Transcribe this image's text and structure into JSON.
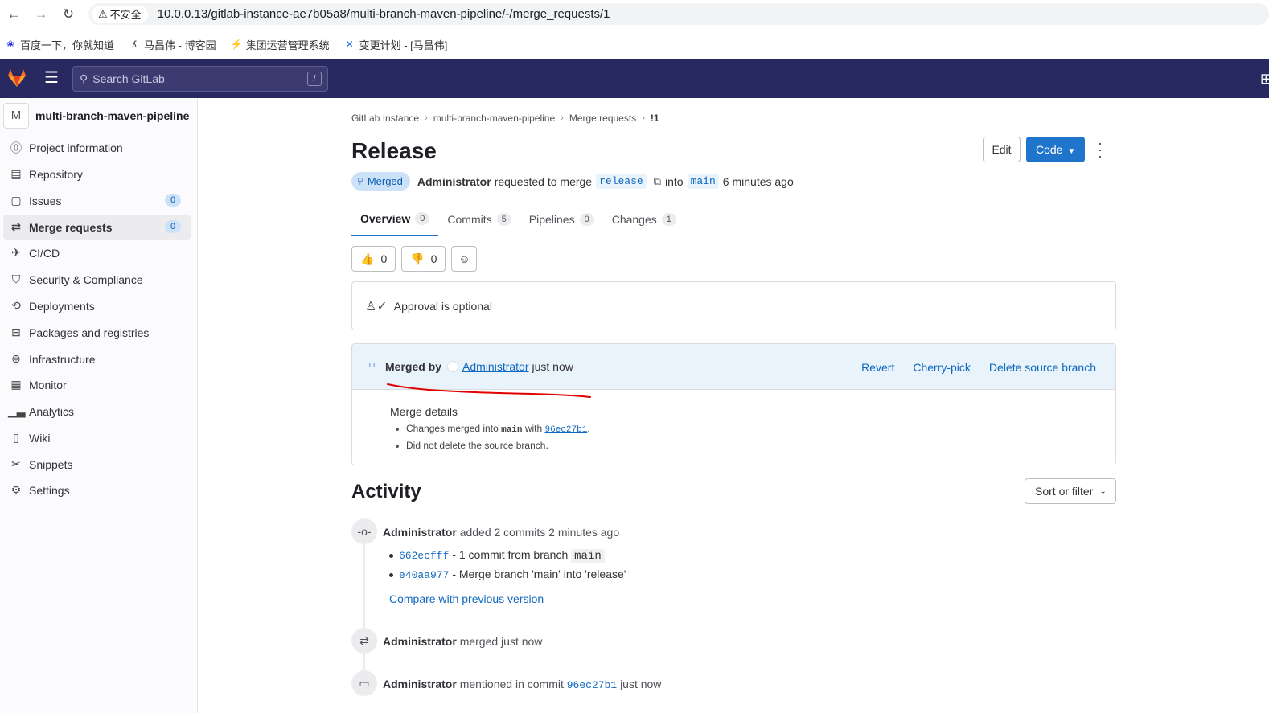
{
  "browser": {
    "insecure_label": "不安全",
    "url": "10.0.0.13/gitlab-instance-ae7b05a8/multi-branch-maven-pipeline/-/merge_requests/1",
    "bookmarks": [
      "百度一下，你就知道",
      "马昌伟 - 博客园",
      "集团运营管理系统",
      "变更计划 - [马昌伟]"
    ]
  },
  "topbar": {
    "search_placeholder": "Search GitLab",
    "search_shortcut": "/"
  },
  "sidebar": {
    "project_initial": "M",
    "project_name": "multi-branch-maven-pipeline",
    "items": [
      {
        "label": "Project information",
        "icon": "info-icon"
      },
      {
        "label": "Repository",
        "icon": "doc-icon"
      },
      {
        "label": "Issues",
        "icon": "issues-icon",
        "badge": "0"
      },
      {
        "label": "Merge requests",
        "icon": "merge-request-icon",
        "badge": "0",
        "active": true
      },
      {
        "label": "CI/CD",
        "icon": "rocket-icon"
      },
      {
        "label": "Security & Compliance",
        "icon": "shield-icon"
      },
      {
        "label": "Deployments",
        "icon": "deployments-icon"
      },
      {
        "label": "Packages and registries",
        "icon": "package-icon"
      },
      {
        "label": "Infrastructure",
        "icon": "infrastructure-icon"
      },
      {
        "label": "Monitor",
        "icon": "monitor-icon"
      },
      {
        "label": "Analytics",
        "icon": "chart-icon"
      },
      {
        "label": "Wiki",
        "icon": "book-icon"
      },
      {
        "label": "Snippets",
        "icon": "scissors-icon"
      },
      {
        "label": "Settings",
        "icon": "gear-icon"
      }
    ]
  },
  "breadcrumb": [
    "GitLab Instance",
    "multi-branch-maven-pipeline",
    "Merge requests",
    "!1"
  ],
  "mr": {
    "title": "Release",
    "edit_label": "Edit",
    "code_label": "Code",
    "status": "Merged",
    "author": "Administrator",
    "requested_text": "requested to merge",
    "source_branch": "release",
    "into_text": "into",
    "target_branch": "main",
    "time_ago": "6 minutes ago"
  },
  "tabs": [
    {
      "label": "Overview",
      "count": "0",
      "active": true
    },
    {
      "label": "Commits",
      "count": "5"
    },
    {
      "label": "Pipelines",
      "count": "0"
    },
    {
      "label": "Changes",
      "count": "1"
    }
  ],
  "reactions": {
    "thumbs_up": "0",
    "thumbs_down": "0"
  },
  "approval": {
    "text": "Approval is optional"
  },
  "merge_widget": {
    "merged_by_label": "Merged by",
    "merger": "Administrator",
    "when": "just now",
    "actions": [
      "Revert",
      "Cherry-pick",
      "Delete source branch"
    ],
    "details_title": "Merge details",
    "detail1_prefix": "Changes merged into",
    "detail1_branch": "main",
    "detail1_with": "with",
    "detail1_sha": "96ec27b1",
    "detail2": "Did not delete the source branch."
  },
  "activity": {
    "title": "Activity",
    "sort_label": "Sort or filter",
    "events": [
      {
        "author": "Administrator",
        "text": "added 2 commits 2 minutes ago"
      },
      {
        "author": "Administrator",
        "text": "merged just now"
      },
      {
        "author": "Administrator",
        "text_before": "mentioned in commit",
        "sha": "96ec27b1",
        "text_after": "just now"
      }
    ],
    "commits": [
      {
        "sha": "662ecfff",
        "text": "- 1 commit from branch",
        "branch": "main"
      },
      {
        "sha": "e40aa977",
        "text": "- Merge branch 'main' into 'release'"
      }
    ],
    "compare_label": "Compare with previous version"
  },
  "colors": {
    "topbar": "#292961",
    "primary": "#1f75cb",
    "link": "#1068bf",
    "annotation": "#e00000"
  }
}
